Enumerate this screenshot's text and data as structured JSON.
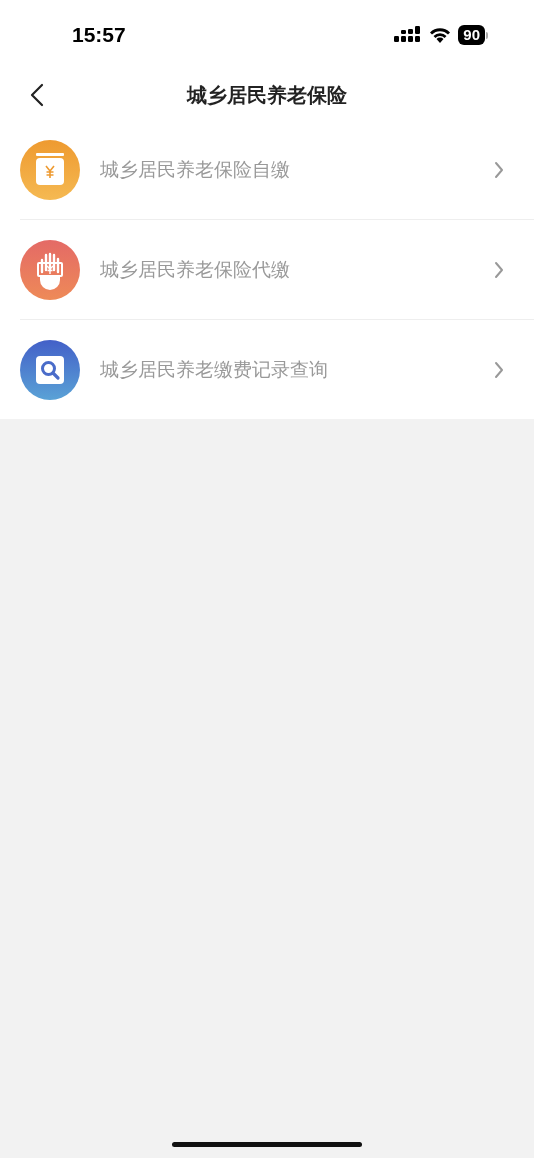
{
  "status_bar": {
    "time": "15:57",
    "battery": "90"
  },
  "nav": {
    "title": "城乡居民养老保险"
  },
  "items": [
    {
      "kind": "jar",
      "label": "城乡居民养老保险自缴"
    },
    {
      "kind": "hand",
      "label": "城乡居民养老保险代缴"
    },
    {
      "kind": "search",
      "label": "城乡居民养老缴费记录查询"
    }
  ]
}
